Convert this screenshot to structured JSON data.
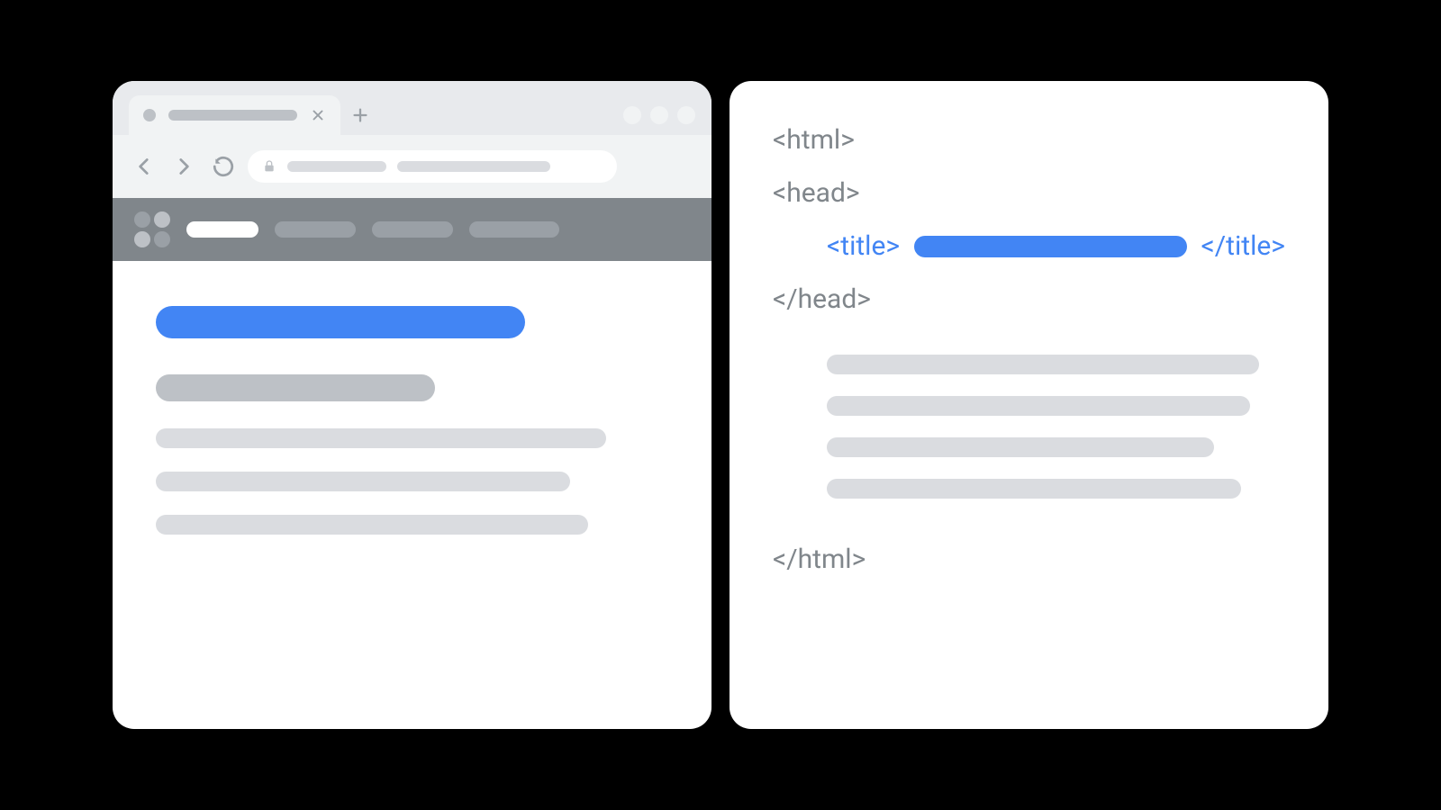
{
  "colors": {
    "accent": "#4285f4",
    "muted": "#bdc1c6",
    "line": "#dadce0",
    "chrome": "#f1f3f4",
    "tabbar": "#e8eaed",
    "sitebar": "#80868b"
  },
  "browser": {
    "window_controls": 3,
    "nav_items": 4,
    "article_lines": 3,
    "site_logo_colors": [
      "#9aa0a6",
      "#bdc1c6",
      "#bdc1c6",
      "#9aa0a6"
    ]
  },
  "code": {
    "tags": {
      "html_open": "<html>",
      "head_open": "<head>",
      "title_open": "<title>",
      "title_close": "</title>",
      "head_close": "</head>",
      "html_close": "</html>"
    },
    "body_line_widths": [
      480,
      470,
      430,
      460
    ]
  }
}
